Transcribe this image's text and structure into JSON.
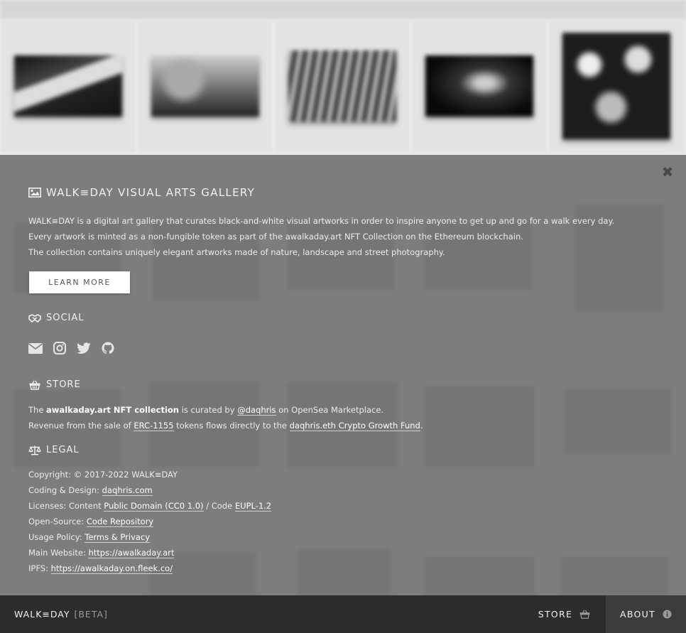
{
  "colors": {
    "overlay": "#7d7d7d",
    "bottombar": "#2c2c2c",
    "about_tab": "#3c3c3c",
    "text": "#ececec",
    "button_bg": "#ffffff"
  },
  "gallery": {
    "thumbnails": [
      "artwork-thumbnail",
      "artwork-thumbnail",
      "artwork-thumbnail",
      "artwork-thumbnail",
      "artwork-thumbnail"
    ]
  },
  "about": {
    "title": "WALK≡DAY VISUAL ARTS GALLERY",
    "title_icon": "image-icon",
    "lines": [
      "WALK≡DAY is a digital art gallery that curates black-and-white visual artworks in order to inspire anyone to get up and go for a walk every day.",
      "Every artwork is minted as a non-fungible token as part of the awalkaday.art NFT Collection on the Ethereum blockchain.",
      "The collection contains uniquely elegant artworks made of nature, landscape and street photography."
    ],
    "learn_more": "LEARN MORE"
  },
  "social": {
    "title": "SOCIAL",
    "title_icon": "handshake-icon",
    "icons": [
      "envelope-icon",
      "instagram-icon",
      "twitter-icon",
      "github-icon"
    ]
  },
  "store": {
    "title": "STORE",
    "title_icon": "basket-icon",
    "line1": {
      "pre": "The ",
      "link": "awalkaday.art NFT collection",
      "mid": " is curated by ",
      "link2": "@daqhris",
      "post": " on OpenSea Marketplace."
    },
    "line2": {
      "pre": "Revenue from the sale of ",
      "link": "ERC-1155",
      "mid": " tokens flows directly to the ",
      "link2": "daqhris.eth Crypto Growth Fund",
      "post": "."
    }
  },
  "legal": {
    "title": "LEGAL",
    "title_icon": "balance-scale-icon",
    "copyright": "Copyright: © 2017-2022 WALK≡DAY",
    "coding": {
      "label": "Coding & Design: ",
      "link": "daqhris.com"
    },
    "licenses": {
      "label": "Licenses: Content ",
      "link": "Public Domain (CC0 1.0)",
      "mid": " / Code ",
      "link2": "EUPL-1.2"
    },
    "opensource": {
      "label": "Open-Source: ",
      "link": "Code Repository"
    },
    "usage": {
      "label": "Usage Policy: ",
      "link": "Terms & Privacy"
    },
    "website": {
      "label": "Main Website: ",
      "link": "https://awalkaday.art"
    },
    "ipfs": {
      "label": "IPFS: ",
      "link": "https://awalkaday.on.fleek.co/"
    }
  },
  "bottombar": {
    "brand": "WALK≡DAY",
    "beta": "[BETA]",
    "store_label": "STORE",
    "about_label": "ABOUT"
  }
}
